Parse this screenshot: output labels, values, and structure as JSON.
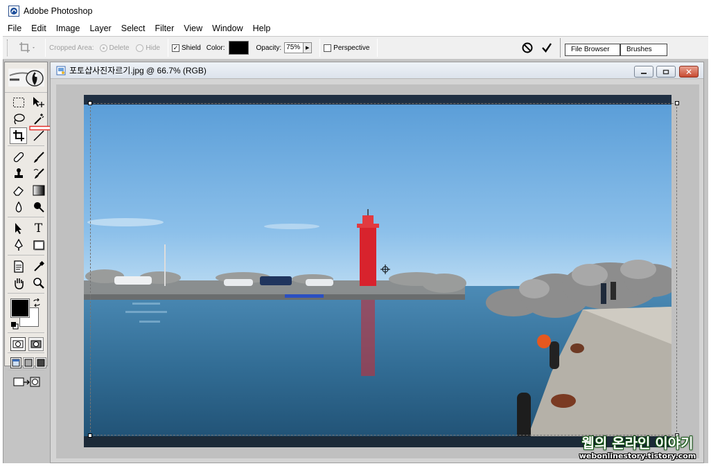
{
  "app": {
    "title": "Adobe Photoshop"
  },
  "menu": [
    "File",
    "Edit",
    "Image",
    "Layer",
    "Select",
    "Filter",
    "View",
    "Window",
    "Help"
  ],
  "options_bar": {
    "cropped_area_label": "Cropped Area:",
    "delete_label": "Delete",
    "hide_label": "Hide",
    "shield_label": "Shield",
    "shield_checked": true,
    "color_label": "Color:",
    "shield_color": "#000000",
    "opacity_label": "Opacity:",
    "opacity_value": "75%",
    "perspective_label": "Perspective",
    "perspective_checked": false
  },
  "palette_well": {
    "tabs": [
      "File Browser",
      "Brushes"
    ]
  },
  "document": {
    "title": "포토샵사진자르기.jpg @ 66.7% (RGB)",
    "close_glyph": "✕"
  },
  "toolbox": {
    "active_tool": "crop-tool",
    "foreground_color": "#000000",
    "background_color": "#ffffff"
  },
  "watermark": {
    "main": "웹의 온라인 이야기",
    "sub": "webonlinestory.tistory.com"
  }
}
